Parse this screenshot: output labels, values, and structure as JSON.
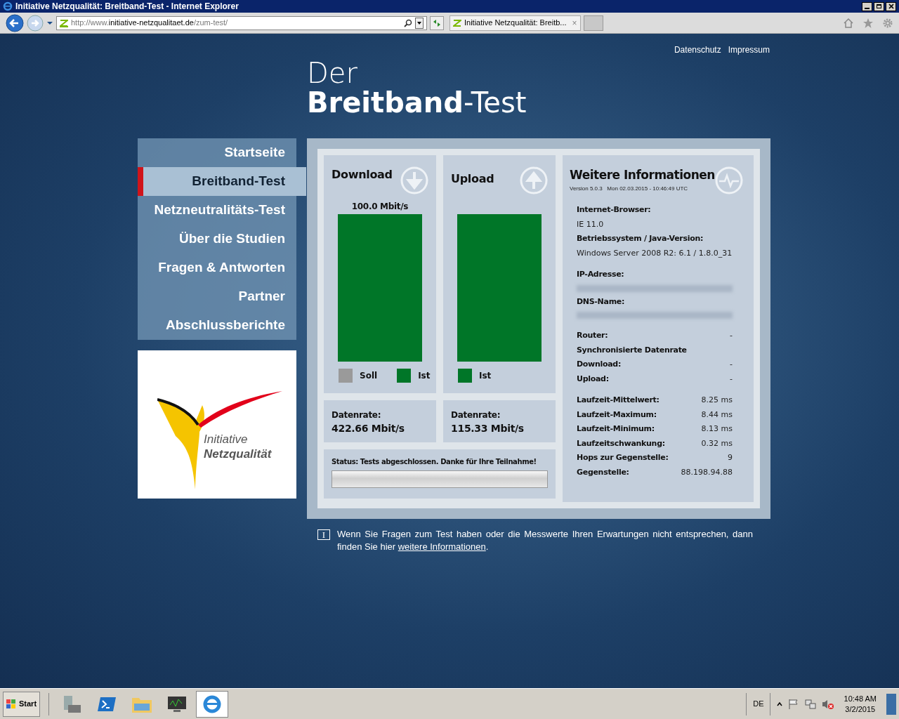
{
  "window": {
    "title": "Initiative Netzqualität: Breitband-Test - Internet Explorer"
  },
  "browser": {
    "address_prefix": "http://www.",
    "address_host": "initiative-netzqualitaet.de",
    "address_path": "/zum-test/",
    "tab": "Initiative Netzqualität: Breitb...",
    "tab_close": "×"
  },
  "top_links": [
    "Datenschutz",
    "Impressum"
  ],
  "heading": {
    "line1": "Der",
    "line2_bold": "Breitband",
    "line2_rest": "-Test"
  },
  "nav": [
    {
      "label": "Startseite",
      "selected": false
    },
    {
      "label": "Breitband-Test",
      "selected": true
    },
    {
      "label": "Netzneutralitäts-Test",
      "selected": false
    },
    {
      "label": "Über die Studien",
      "selected": false
    },
    {
      "label": "Fragen & Antworten",
      "selected": false
    },
    {
      "label": "Partner",
      "selected": false
    },
    {
      "label": "Abschlussberichte",
      "selected": false
    }
  ],
  "logo": {
    "line1": "Initiative",
    "line2": "Netzqualität"
  },
  "tests": [
    {
      "kind": "download",
      "title": "Download",
      "target": "100.0 Mbit/s",
      "legend": [
        {
          "label": "Soll",
          "color": "#9a9a9a"
        },
        {
          "label": "Ist",
          "color": "#007628"
        }
      ],
      "rate_label": "Datenrate:",
      "rate": "422.66 Mbit/s"
    },
    {
      "kind": "upload",
      "title": "Upload",
      "legend": [
        {
          "label": "Ist",
          "color": "#007628"
        }
      ],
      "rate_label": "Datenrate:",
      "rate": "115.33 Mbit/s"
    }
  ],
  "status": "Status: Tests abgeschlossen. Danke für Ihre Teilnahme!",
  "progress": {
    "level": 1.0
  },
  "info": {
    "title": "Weitere Informationen",
    "version": "Version 5.0.3   Mon 02.03.2015 - 10:46:49 UTC",
    "groups": [
      [
        {
          "kind": "stacked",
          "label": "Internet-Browser:",
          "value": "IE 11.0"
        },
        {
          "kind": "stacked",
          "label": "Betriebssystem / Java-Version:",
          "value": "Windows Server 2008 R2: 6.1 / 1.8.0_31"
        }
      ],
      [
        {
          "kind": "redacted",
          "label": "IP-Adresse:"
        },
        {
          "kind": "redacted",
          "label": "DNS-Name:"
        }
      ],
      [
        {
          "kind": "pair",
          "label": "Router:",
          "value": "-"
        },
        {
          "kind": "heading",
          "label": "Synchronisierte Datenrate"
        },
        {
          "kind": "pair",
          "label": "Download:",
          "value": "-"
        },
        {
          "kind": "pair",
          "label": "Upload:",
          "value": "-"
        }
      ],
      [
        {
          "kind": "pair",
          "label": "Laufzeit-Mittelwert:",
          "value": "8.25 ms"
        },
        {
          "kind": "pair",
          "label": "Laufzeit-Maximum:",
          "value": "8.44 ms"
        },
        {
          "kind": "pair",
          "label": "Laufzeit-Minimum:",
          "value": "8.13 ms"
        },
        {
          "kind": "pair",
          "label": "Laufzeitschwankung:",
          "value": "0.32 ms"
        },
        {
          "kind": "pair",
          "label": "Hops zur Gegenstelle:",
          "value": "9"
        },
        {
          "kind": "pair",
          "label": "Gegenstelle:",
          "value": "88.198.94.88"
        }
      ]
    ]
  },
  "note": {
    "icon": "I",
    "text": "Wenn Sie Fragen zum Test haben oder die Messwerte Ihren Erwartungen nicht entsprechen, dann finden Sie hier",
    "link": "weitere Informationen",
    "after": "."
  },
  "taskbar": {
    "start": "Start",
    "language": "DE",
    "time": "10:48 AM",
    "date": "3/2/2015"
  }
}
